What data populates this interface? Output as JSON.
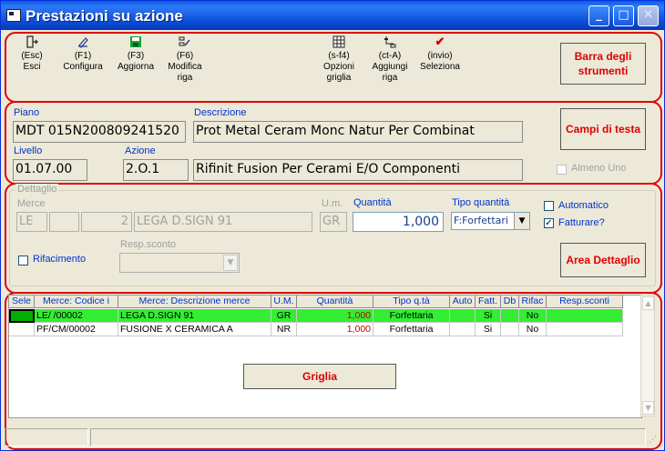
{
  "window": {
    "title": "Prestazioni su azione"
  },
  "toolbar": {
    "items": [
      {
        "key": "(Esc)",
        "label": "Esci",
        "icon": "exit-icon"
      },
      {
        "key": "(F1)",
        "label": "Configura",
        "icon": "configure-icon"
      },
      {
        "key": "(F3)",
        "label": "Aggiorna",
        "icon": "save-icon"
      },
      {
        "key": "(F6)",
        "label": "Modifica riga",
        "icon": "edit-row-icon"
      },
      {
        "key": "(s-f4)",
        "label": "Opzioni griglia",
        "icon": "grid-options-icon"
      },
      {
        "key": "(ct-A)",
        "label": "Aggiungi riga",
        "icon": "add-row-icon"
      },
      {
        "key": "(invio)",
        "label": "Seleziona",
        "icon": "select-check-icon"
      }
    ]
  },
  "callouts": {
    "toolbar": "Barra degli strumenti",
    "header": "Campi di testa",
    "detail": "Area Dettaglio",
    "grid": "Griglia"
  },
  "header": {
    "piano_label": "Piano",
    "piano_value": "MDT 015N200809241520",
    "descrizione_label": "Descrizione",
    "descrizione_value": "Prot Metal Ceram Monc Natur Per Combinat",
    "livello_label": "Livello",
    "livello_value": "01.07.00",
    "azione_label": "Azione",
    "azione_value": "2.O.1",
    "azione_desc": "Rifinit Fusion Per Cerami E/O Componenti",
    "almeno_uno_label": "Almeno Uno"
  },
  "detail": {
    "legend": "Dettaglio",
    "merce_label": "Merce",
    "merce_1": "LE",
    "merce_2": "",
    "merce_3": "2",
    "merce_desc": "LEGA D.SIGN 91",
    "um_label": "U.m.",
    "um_value": "GR",
    "quantita_label": "Quantità",
    "quantita_value": "1,000",
    "tipo_label": "Tipo quantità",
    "tipo_value": "F:Forfettari",
    "automatico_label": "Automatico",
    "fatturare_label": "Fatturare?",
    "rifacimento_label": "Rifacimento",
    "resp_label": "Resp.sconto",
    "resp_value": ""
  },
  "grid": {
    "columns": [
      "Sele",
      "Merce: Codice i",
      "Merce: Descrizione merce",
      "U.M.",
      "Quantità",
      "Tipo q.tà",
      "Auto",
      "Fatt.",
      "Db",
      "Rifac",
      "Resp.sconti"
    ],
    "rows": [
      {
        "sel": "",
        "codice": "LE/  /00002",
        "descr": "LEGA D.SIGN 91",
        "um": "GR",
        "qta": "1,000",
        "tipo": "Forfettaria",
        "auto": "",
        "fatt": "Si",
        "db": "",
        "rifac": "No",
        "resp": ""
      },
      {
        "sel": "",
        "codice": "PF/CM/00002",
        "descr": "FUSIONE X CERAMICA A",
        "um": "NR",
        "qta": "1,000",
        "tipo": "Forfettaria",
        "auto": "",
        "fatt": "Si",
        "db": "",
        "rifac": "No",
        "resp": ""
      }
    ]
  },
  "colors": {
    "highlight_row": "#33ee33",
    "callout_text": "#e00000",
    "label_text": "#0033cc"
  }
}
